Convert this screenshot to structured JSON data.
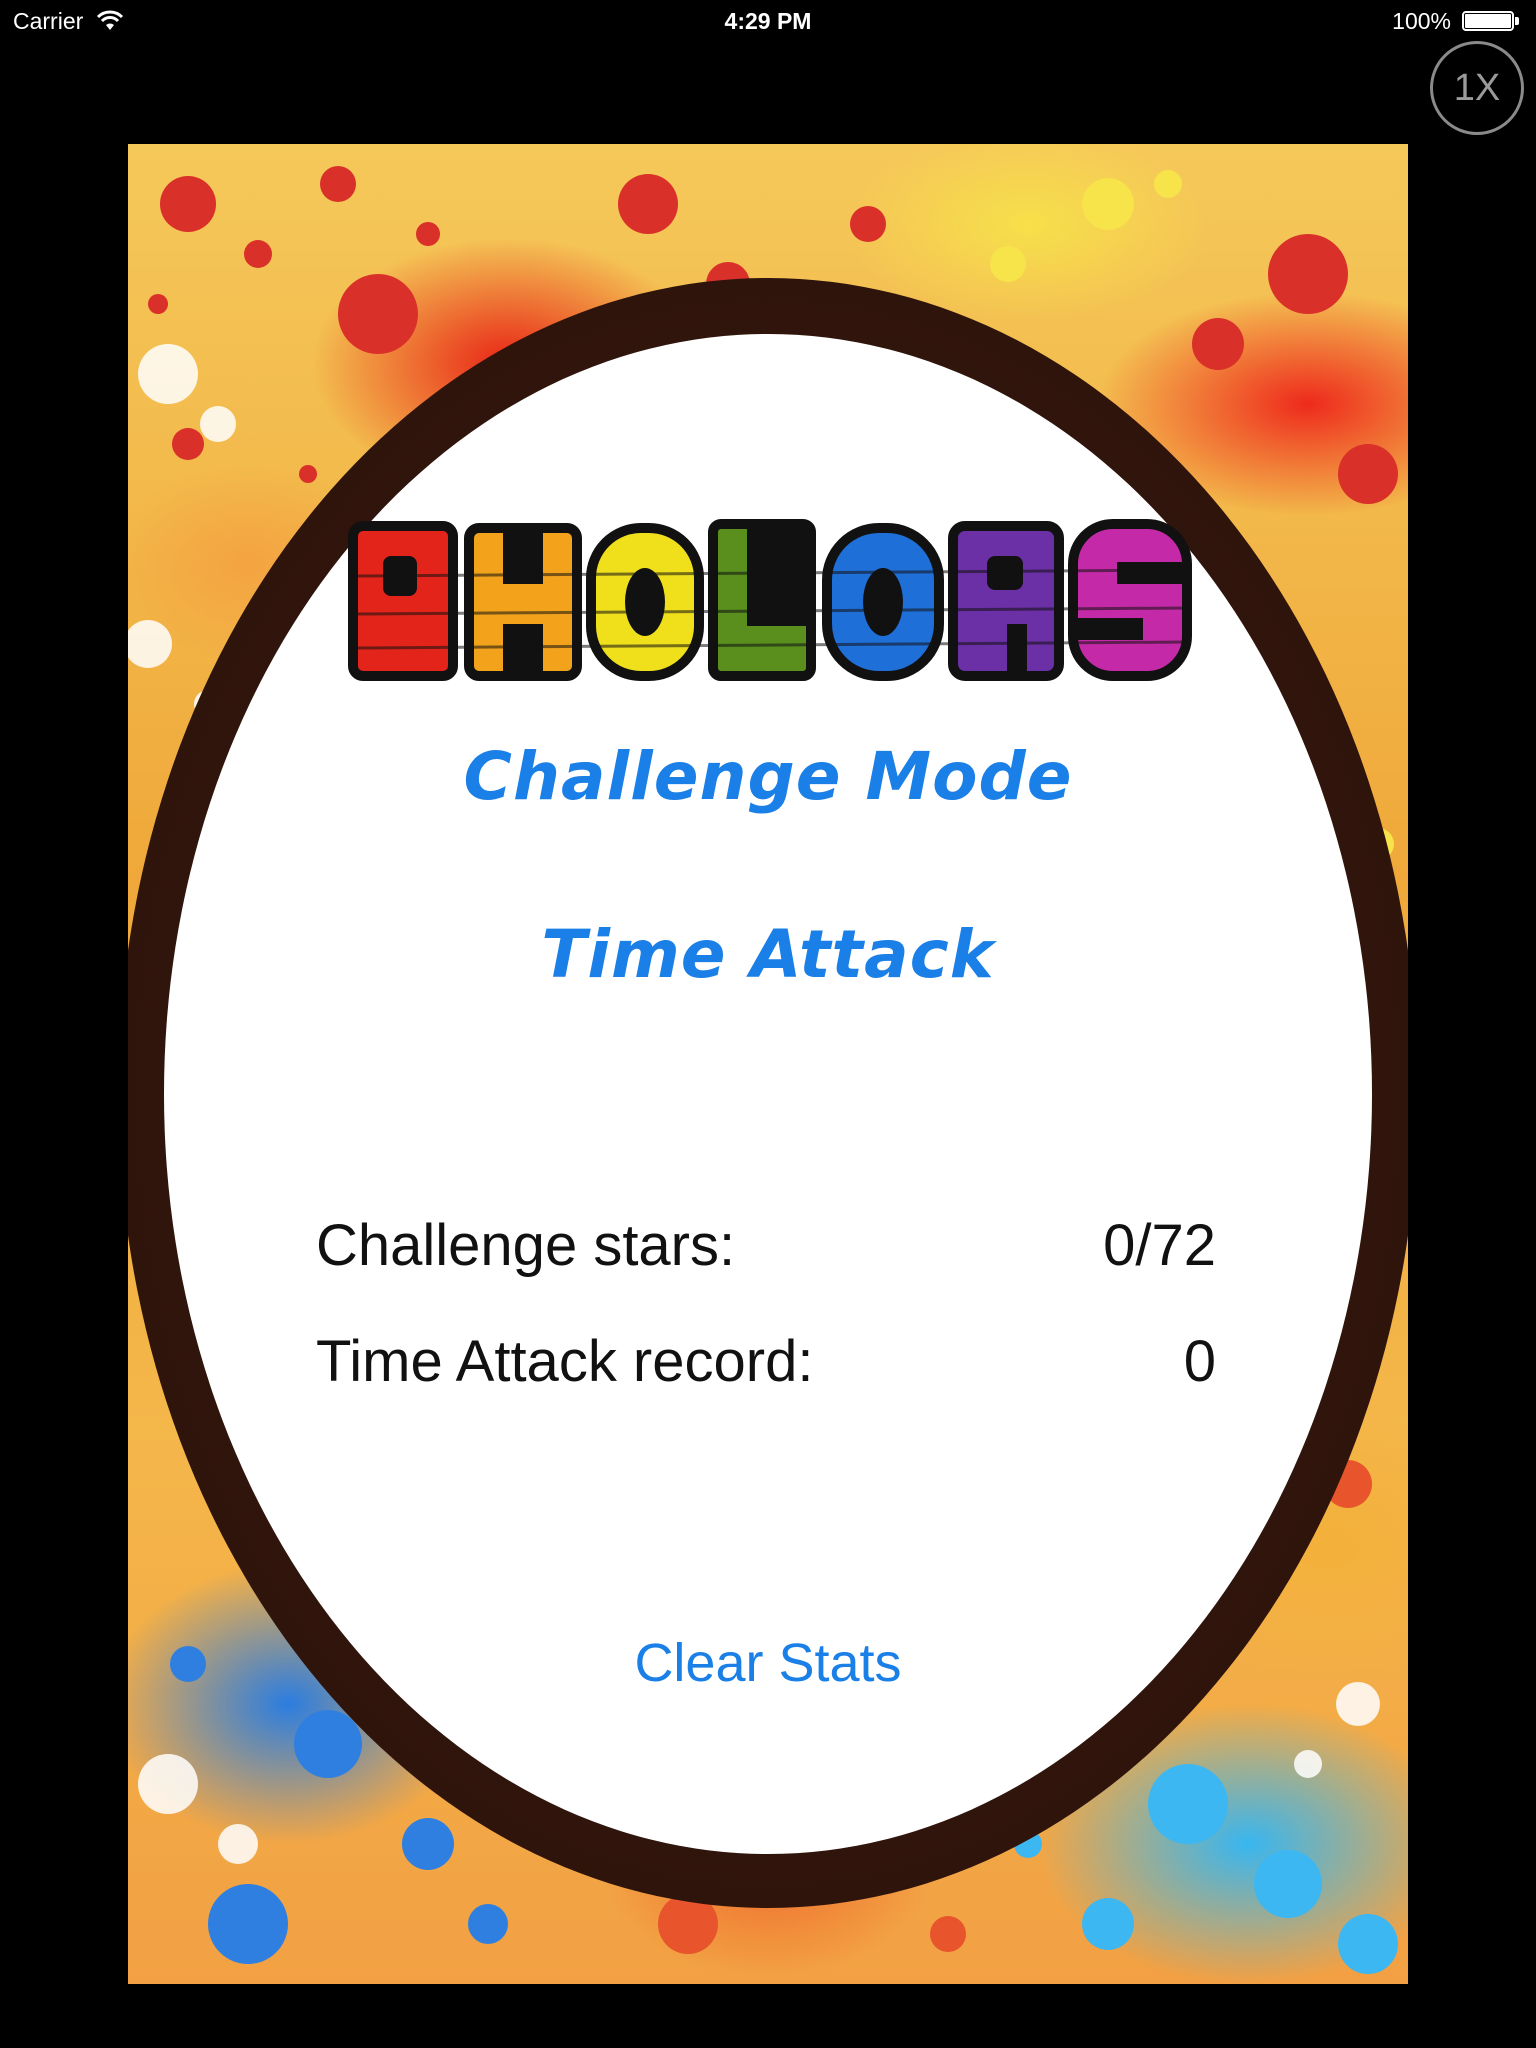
{
  "status_bar": {
    "carrier": "Carrier",
    "time": "4:29 PM",
    "battery": "100%"
  },
  "zoom_button": {
    "label": "1X"
  },
  "logo": {
    "text": "PHOLORS",
    "letter_colors": [
      "#e3241b",
      "#f2a31b",
      "#f0e01c",
      "#5a8f1e",
      "#1f6fd8",
      "#6b2fa6",
      "#c42aa8"
    ]
  },
  "menu": {
    "challenge_mode": "Challenge Mode",
    "time_attack": "Time Attack"
  },
  "stats": [
    {
      "label": "Challenge stars:",
      "value": "0/72"
    },
    {
      "label": "Time Attack record:",
      "value": "0"
    }
  ],
  "clear_stats": "Clear Stats",
  "colors": {
    "accent": "#1a7fe6",
    "ring": "#2a120b"
  }
}
